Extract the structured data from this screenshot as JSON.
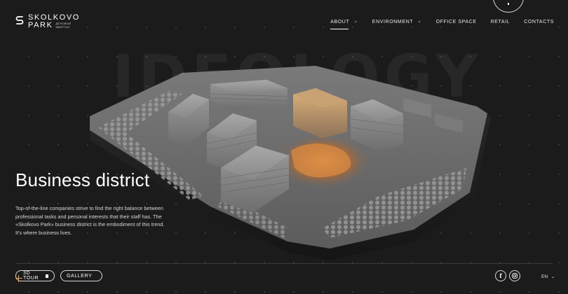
{
  "brand": {
    "name_line1": "SKOLKOVO",
    "name_line2": "PARK",
    "subtitle_line1": "ДЕЛОВОЙ",
    "subtitle_line2": "КВАРТАЛ"
  },
  "nav": {
    "items": [
      {
        "label": "ABOUT",
        "has_dropdown": true,
        "active": true
      },
      {
        "label": "ENVIRONMENT",
        "has_dropdown": true,
        "active": false
      },
      {
        "label": "OFFICE SPACE",
        "has_dropdown": false,
        "active": false
      },
      {
        "label": "RETAIL",
        "has_dropdown": false,
        "active": false
      },
      {
        "label": "CONTACTS",
        "has_dropdown": false,
        "active": false
      }
    ]
  },
  "hero": {
    "watermark": "IDEOLOGY",
    "title": "Business district",
    "description": "Top-of-the-line companies strive to find the right balance between professional tasks and personal interests that their staff has. The «Skolkovo Park» business district is the embodiment of this trend. It's where business lives."
  },
  "footer": {
    "tour_label": "3D TOUR",
    "gallery_label": "GALLERY",
    "facebook_icon": "f",
    "language": "EN",
    "language_chevron": "⌄"
  },
  "colors": {
    "background": "#1b1b1b",
    "accent_warm": "#e8a35b",
    "text": "#ffffff"
  }
}
